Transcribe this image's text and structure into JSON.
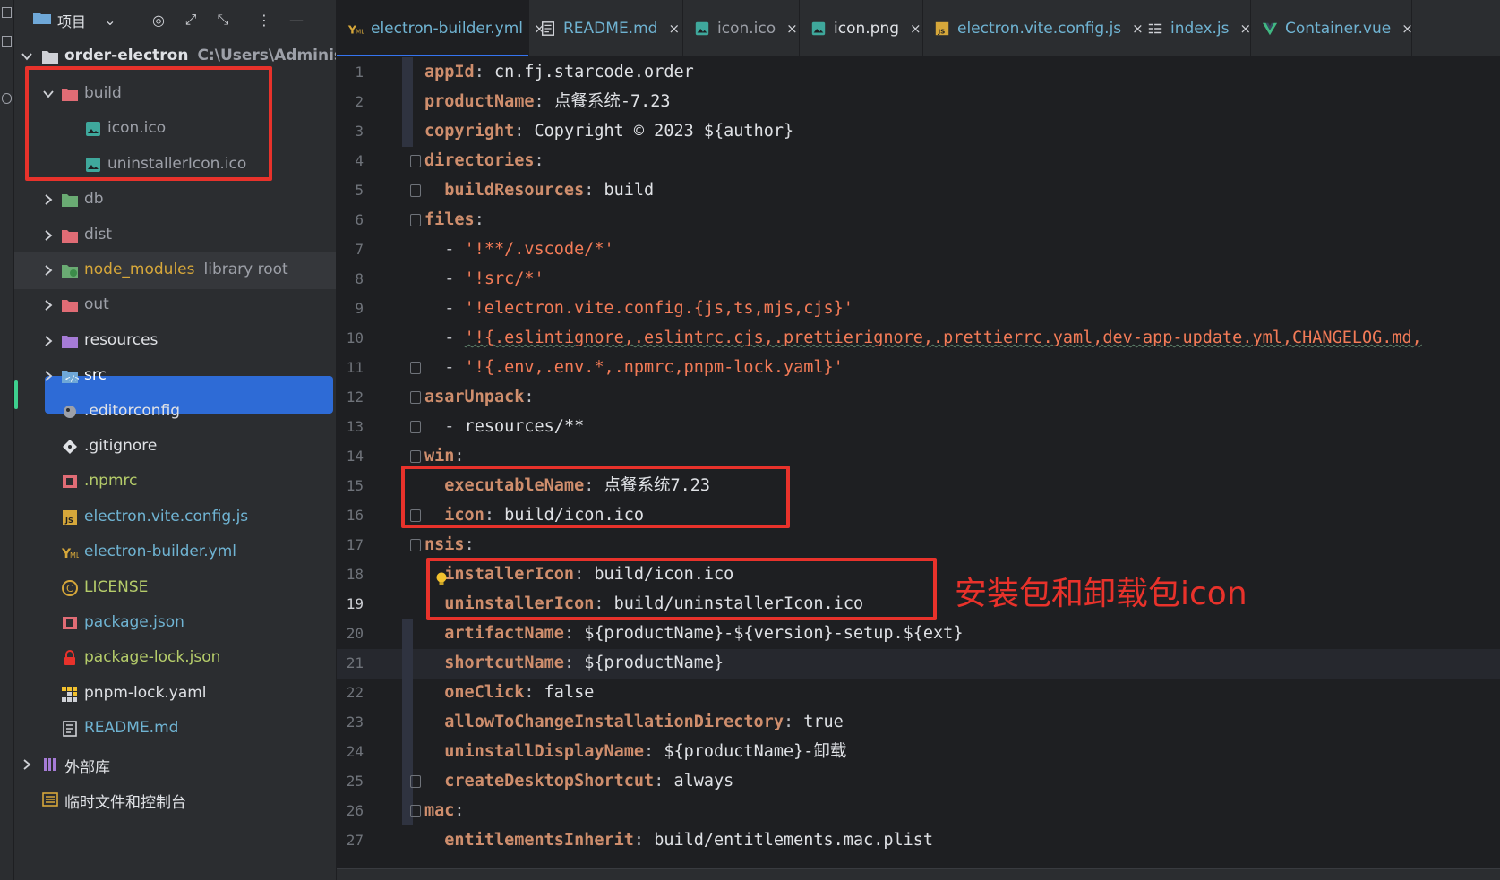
{
  "project_panel": {
    "title": "项目",
    "root": {
      "name": "order-electron",
      "path": "C:\\Users\\Administr"
    },
    "tree": [
      {
        "label": "build",
        "icon": "folder-excluded-icon",
        "color": "#9da0a8"
      },
      {
        "label": "icon.ico",
        "icon": "image-icon",
        "color": "#9da0a8"
      },
      {
        "label": "uninstallerIcon.ico",
        "icon": "image-icon",
        "color": "#9da0a8"
      },
      {
        "label": "db",
        "icon": "folder-db-icon",
        "color": "#9da0a8"
      },
      {
        "label": "dist",
        "icon": "folder-excluded-icon",
        "color": "#9da0a8"
      },
      {
        "label": "node_modules",
        "sub": "library root",
        "icon": "folder-node-icon",
        "color": "#d6a73a"
      },
      {
        "label": "out",
        "icon": "folder-excluded-icon",
        "color": "#9da0a8"
      },
      {
        "label": "resources",
        "icon": "folder-resources-icon",
        "color": "#dfe1e5"
      },
      {
        "label": "src",
        "icon": "folder-source-icon",
        "color": "#ffffff"
      },
      {
        "label": ".editorconfig",
        "icon": "editorconfig-icon",
        "color": "#dfe1e5"
      },
      {
        "label": ".gitignore",
        "icon": "git-icon",
        "color": "#dfe1e5"
      },
      {
        "label": ".npmrc",
        "icon": "npm-icon",
        "color": "#b5cc6a"
      },
      {
        "label": "electron.vite.config.js",
        "icon": "js-file-icon",
        "color": "#6fb3d2"
      },
      {
        "label": "electron-builder.yml",
        "icon": "yaml-file-icon",
        "color": "#6fb3d2"
      },
      {
        "label": "LICENSE",
        "icon": "license-icon",
        "color": "#b5cc6a"
      },
      {
        "label": "package.json",
        "icon": "npm-icon",
        "color": "#6fb3d2"
      },
      {
        "label": "package-lock.json",
        "icon": "lock-icon",
        "color": "#b5cc6a"
      },
      {
        "label": "pnpm-lock.yaml",
        "icon": "pnpm-icon",
        "color": "#dfe1e5"
      },
      {
        "label": "README.md",
        "icon": "markdown-icon",
        "color": "#6fb3d2"
      },
      {
        "label": "外部库",
        "icon": "library-icon",
        "color": "#dfe1e5"
      },
      {
        "label": "临时文件和控制台",
        "icon": "scratches-icon",
        "color": "#dfe1e5"
      }
    ]
  },
  "tabs": [
    {
      "label": "electron-builder.yml",
      "icon": "yaml-file-icon",
      "color": "#6fb3d2",
      "active": true
    },
    {
      "label": "README.md",
      "icon": "markdown-icon",
      "color": "#6fb3d2"
    },
    {
      "label": "icon.ico",
      "icon": "image-icon",
      "color": "#9da0a8"
    },
    {
      "label": "icon.png",
      "icon": "image-icon",
      "color": "#dfe1e5"
    },
    {
      "label": "electron.vite.config.js",
      "icon": "js-file-icon",
      "color": "#6fb3d2"
    },
    {
      "label": "index.js",
      "icon": "structure-icon",
      "color": "#6fb3d2"
    },
    {
      "label": "Container.vue",
      "icon": "vue-icon",
      "color": "#6fb3d2"
    }
  ],
  "editor": {
    "current_line": 19,
    "lines": [
      [
        [
          "k",
          "appId"
        ],
        [
          "p",
          ": "
        ],
        [
          "v",
          "cn.fj.starcode.order"
        ]
      ],
      [
        [
          "k",
          "productName"
        ],
        [
          "p",
          ": "
        ],
        [
          "v",
          "点餐系统-7.23"
        ]
      ],
      [
        [
          "k",
          "copyright"
        ],
        [
          "p",
          ": "
        ],
        [
          "v",
          "Copyright © 2023 ${author}"
        ]
      ],
      [
        [
          "k",
          "directories"
        ],
        [
          "p",
          ":"
        ]
      ],
      [
        [
          "p",
          "  "
        ],
        [
          "k",
          "buildResources"
        ],
        [
          "p",
          ": "
        ],
        [
          "v",
          "build"
        ]
      ],
      [
        [
          "k",
          "files"
        ],
        [
          "p",
          ":"
        ]
      ],
      [
        [
          "p",
          "  - "
        ],
        [
          "sq",
          "'!**/.vscode/*'"
        ]
      ],
      [
        [
          "p",
          "  - "
        ],
        [
          "sq",
          "'!src/*'"
        ]
      ],
      [
        [
          "p",
          "  - "
        ],
        [
          "sq",
          "'!electron.vite.config.{js,ts,mjs,cjs}'"
        ]
      ],
      [
        [
          "p",
          "  - "
        ],
        [
          "sq",
          "'!{.eslintignore,.eslintrc.cjs,.prettierignore,.prettierrc.yaml,dev-app-update.yml,CHANGELOG.md,"
        ]
      ],
      [
        [
          "p",
          "  - "
        ],
        [
          "sq",
          "'!{.env,.env.*,.npmrc,pnpm-lock.yaml}'"
        ]
      ],
      [
        [
          "k",
          "asarUnpack"
        ],
        [
          "p",
          ":"
        ]
      ],
      [
        [
          "p",
          "  - "
        ],
        [
          "v",
          "resources/**"
        ]
      ],
      [
        [
          "k",
          "win"
        ],
        [
          "p",
          ":"
        ]
      ],
      [
        [
          "p",
          "  "
        ],
        [
          "k",
          "executableName"
        ],
        [
          "p",
          ": "
        ],
        [
          "v",
          "点餐系统7.23"
        ]
      ],
      [
        [
          "p",
          "  "
        ],
        [
          "k",
          "icon"
        ],
        [
          "p",
          ": "
        ],
        [
          "v",
          "build/icon.ico"
        ]
      ],
      [
        [
          "k",
          "nsis"
        ],
        [
          "p",
          ":"
        ]
      ],
      [
        [
          "p",
          "  "
        ],
        [
          "k",
          "installerIcon"
        ],
        [
          "p",
          ": "
        ],
        [
          "v",
          "build/icon.ico"
        ]
      ],
      [
        [
          "p",
          "  "
        ],
        [
          "k",
          "uninstallerIcon"
        ],
        [
          "p",
          ": "
        ],
        [
          "v",
          "build/uninstallerIcon.ico"
        ]
      ],
      [
        [
          "p",
          "  "
        ],
        [
          "k",
          "artifactName"
        ],
        [
          "p",
          ": "
        ],
        [
          "v",
          "${productName}-${version}-setup.${ext}"
        ]
      ],
      [
        [
          "p",
          "  "
        ],
        [
          "k",
          "shortcutName"
        ],
        [
          "p",
          ": "
        ],
        [
          "v",
          "${productName}"
        ]
      ],
      [
        [
          "p",
          "  "
        ],
        [
          "k",
          "oneClick"
        ],
        [
          "p",
          ": "
        ],
        [
          "v",
          "false"
        ]
      ],
      [
        [
          "p",
          "  "
        ],
        [
          "k",
          "allowToChangeInstallationDirectory"
        ],
        [
          "p",
          ": "
        ],
        [
          "v",
          "true"
        ]
      ],
      [
        [
          "p",
          "  "
        ],
        [
          "k",
          "uninstallDisplayName"
        ],
        [
          "p",
          ": "
        ],
        [
          "v",
          "${productName}-卸载"
        ]
      ],
      [
        [
          "p",
          "  "
        ],
        [
          "k",
          "createDesktopShortcut"
        ],
        [
          "p",
          ": "
        ],
        [
          "v",
          "always"
        ]
      ],
      [
        [
          "k",
          "mac"
        ],
        [
          "p",
          ":"
        ]
      ],
      [
        [
          "p",
          "  "
        ],
        [
          "k",
          "entitlementsInherit"
        ],
        [
          "p",
          ": "
        ],
        [
          "v",
          "build/entitlements.mac.plist"
        ]
      ]
    ]
  },
  "annotation": {
    "text": "安装包和卸载包icon"
  },
  "colors": {
    "accent": "#3574f0",
    "selection": "#2e6bd6",
    "annotation_red": "#e8322b"
  }
}
